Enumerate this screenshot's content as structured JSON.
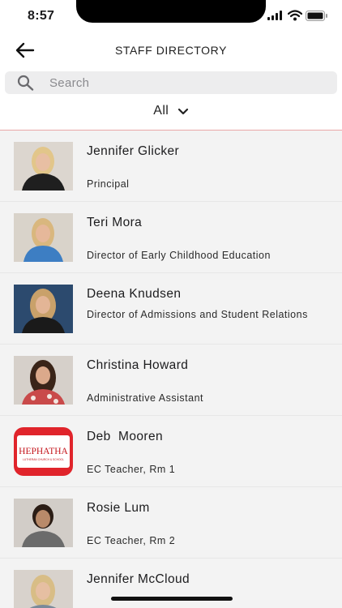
{
  "status_bar": {
    "time": "8:57"
  },
  "header": {
    "title": "STAFF DIRECTORY",
    "back_icon": "arrow-left-icon"
  },
  "search": {
    "placeholder": "Search",
    "value": ""
  },
  "filter": {
    "label": "All",
    "icon": "chevron-down-icon"
  },
  "staff": [
    {
      "name": "Jennifer Glicker",
      "role": "Principal"
    },
    {
      "name": "Teri Mora",
      "role": "Director of Early Childhood Education"
    },
    {
      "name": "Deena Knudsen",
      "role": "Director of Admissions and Student Relations"
    },
    {
      "name": "Christina Howard",
      "role": "Administrative Assistant"
    },
    {
      "name": "Deb  Mooren",
      "role": "EC Teacher, Rm 1",
      "logo_text": "HEPHATHA",
      "logo_subtext": "LUTHERAN CHURCH & SCHOOL"
    },
    {
      "name": "Rosie Lum",
      "role": "EC Teacher, Rm 2"
    },
    {
      "name": "Jennifer McCloud",
      "role": ""
    }
  ],
  "colors": {
    "logo_red": "#e0242b",
    "divider": "#e9a7a7",
    "list_bg": "#f3f3f3"
  }
}
